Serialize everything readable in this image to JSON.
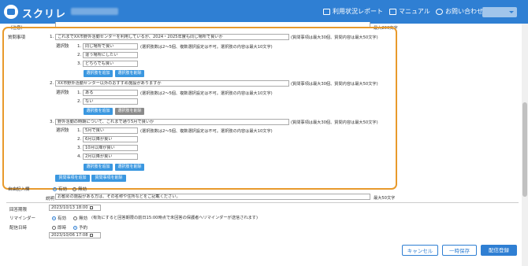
{
  "header": {
    "app_title": "スクリレ",
    "nav": [
      "利用状況レポート",
      "マニュアル",
      "お問い合わせ"
    ]
  },
  "top": {
    "note_label": "（注意）",
    "limit": "最大200文字"
  },
  "survey": {
    "label": "質問事項",
    "choices_label": "選択肢",
    "question_hint": "(質問事項は最大30個、質問内容は最大50文字)",
    "choice_hint": "(選択肢数は2〜5個、複数選択設定は不可。選択肢の内容は最大10文字)",
    "add_choice": "選択肢を追加",
    "del_choice": "選択肢を削除",
    "add_question": "質問事項を追加",
    "del_question": "質問事項を削除",
    "questions": [
      {
        "no": "1.",
        "text": "これまでXX市野外活動センターを利用しているが、2024・2025年度も同じ場所で良いか",
        "choices": [
          {
            "no": "1.",
            "text": "同じ場所で良い"
          },
          {
            "no": "2.",
            "text": "違う場所にしたい"
          },
          {
            "no": "3.",
            "text": "どちらでも良い"
          }
        ]
      },
      {
        "no": "2.",
        "text": "XX市野外活動センター以外のおすすめ施設がありますか",
        "choices": [
          {
            "no": "1.",
            "text": "ある"
          },
          {
            "no": "2.",
            "text": "ない"
          }
        ]
      },
      {
        "no": "3.",
        "text": "野外活動の時期について、これまで通り5月で良いか",
        "choices": [
          {
            "no": "1.",
            "text": "5月で良い"
          },
          {
            "no": "2.",
            "text": "6月以降が良い"
          },
          {
            "no": "3.",
            "text": "10月以降が良い"
          },
          {
            "no": "4.",
            "text": "2月以降が良い"
          }
        ]
      }
    ]
  },
  "free_entry": {
    "label": "自由記入欄",
    "opt_yes": "有効",
    "opt_no": "無効",
    "desc_label": "説明",
    "desc_value": "お勧めの施設がある方は、その名称や住所などをご記載ください。",
    "desc_limit": "最大50文字"
  },
  "deadline": {
    "label": "回答期限",
    "value": "2023/10/13 18:00"
  },
  "reminder": {
    "label": "リマインダー",
    "opt_on": "有効",
    "opt_off": "無効",
    "note": "(有効にすると回答期限の前日15:00時点で未回答の保護者へリマインダーが送信されます)"
  },
  "delivery": {
    "label": "配信日時",
    "opt_now": "即時",
    "opt_sched": "予約",
    "value": "2023/10/06 17:08"
  },
  "actions": {
    "cancel": "キャンセル",
    "draft": "一時保存",
    "send": "配信登録"
  }
}
